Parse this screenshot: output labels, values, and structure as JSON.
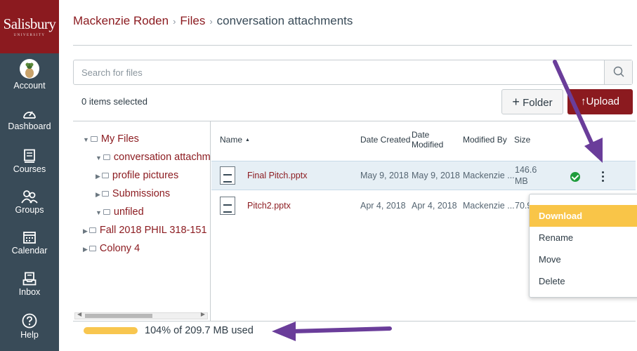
{
  "brand": {
    "name": "Salisbury",
    "subtitle": "UNIVERSITY",
    "color": "#8b1a1f"
  },
  "global_nav": {
    "items": [
      {
        "label": "Account",
        "icon": "user-avatar-icon"
      },
      {
        "label": "Dashboard",
        "icon": "dashboard-gauge-icon"
      },
      {
        "label": "Courses",
        "icon": "book-icon"
      },
      {
        "label": "Groups",
        "icon": "people-icon"
      },
      {
        "label": "Calendar",
        "icon": "calendar-icon"
      },
      {
        "label": "Inbox",
        "icon": "inbox-icon"
      },
      {
        "label": "Help",
        "icon": "help-question-icon"
      }
    ]
  },
  "breadcrumb": {
    "user": "Mackenzie Roden",
    "files": "Files",
    "current": "conversation attachments"
  },
  "search": {
    "placeholder": "Search for files",
    "value": ""
  },
  "toolbar": {
    "selected_info": "0 items selected",
    "folder_label": "Folder",
    "upload_label": "Upload"
  },
  "tree": {
    "items": [
      {
        "label": "My Files",
        "level": 0,
        "expanded": true
      },
      {
        "label": "conversation attachments",
        "level": 1,
        "expanded": true
      },
      {
        "label": "profile pictures",
        "level": 1,
        "expanded": false
      },
      {
        "label": "Submissions",
        "level": 1,
        "expanded": false
      },
      {
        "label": "unfiled",
        "level": 1,
        "expanded": true
      },
      {
        "label": "Fall 2018 PHIL 318-151",
        "level": 0,
        "expanded": false
      },
      {
        "label": "Colony 4",
        "level": 0,
        "expanded": false
      }
    ]
  },
  "table": {
    "columns": {
      "name": "Name",
      "sort_indicator": "▲",
      "created": "Date Created",
      "modified_line1": "Date",
      "modified_line2": "Modified",
      "modified_by": "Modified By",
      "size": "Size"
    },
    "rows": [
      {
        "name": "Final Pitch.pptx",
        "created": "May 9, 2018",
        "modified": "May 9, 2018",
        "modified_by": "Mackenzie ...",
        "size_line1": "146.6",
        "size_line2": "MB",
        "published": true,
        "selected": true
      },
      {
        "name": "Pitch2.pptx",
        "created": "Apr 4, 2018",
        "modified": "Apr 4, 2018",
        "modified_by": "Mackenzie ...",
        "size": "70.9",
        "selected": false
      }
    ]
  },
  "context_menu": {
    "items": [
      "Download",
      "Rename",
      "Move",
      "Delete"
    ],
    "active": "Download"
  },
  "quota": {
    "text": "104% of 209.7 MB used",
    "percent": 104
  },
  "annotations": {
    "arrow_color": "#6a3d9a"
  }
}
